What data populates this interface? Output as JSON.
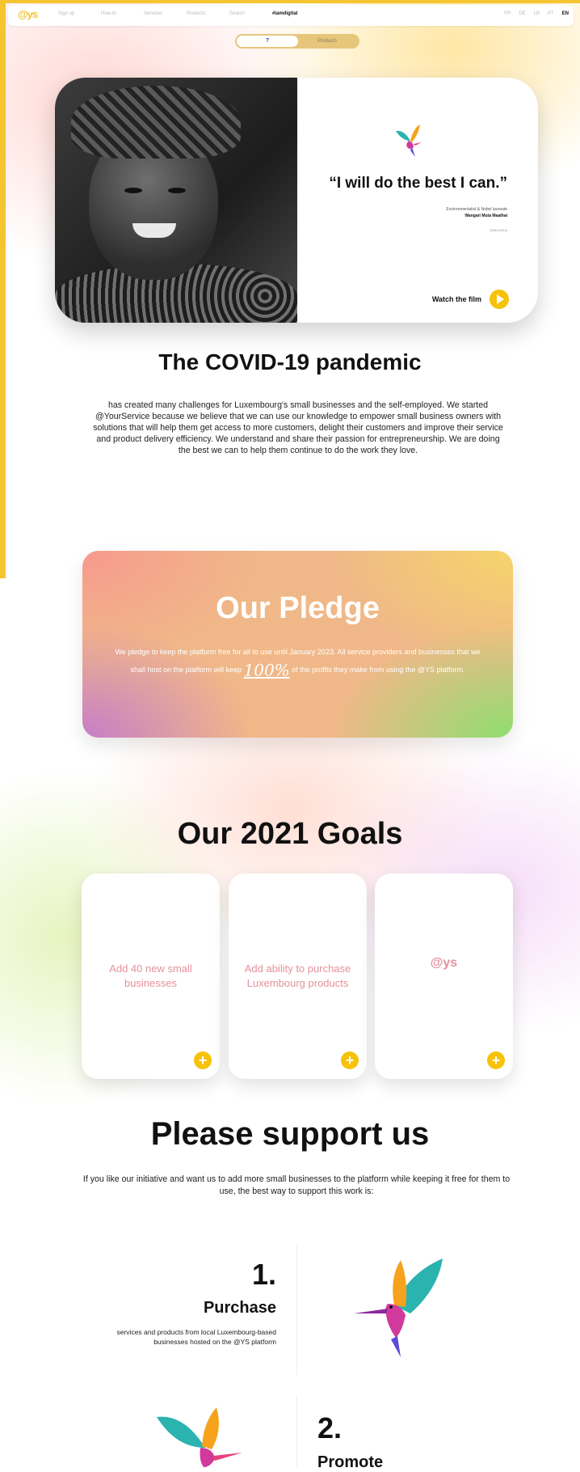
{
  "nav": {
    "logo": "@ys",
    "links": [
      "Sign up",
      "How-to",
      "Services",
      "Products",
      "Search",
      "#iamdigital"
    ],
    "active_index": 5,
    "right_links": [
      "FR",
      "DE",
      "LB",
      "PT",
      "EN"
    ],
    "right_active_index": 4
  },
  "toggle": {
    "option_a": "?",
    "option_b": "Products"
  },
  "hero": {
    "quote": "“I will do the best I can.”",
    "attribution_role": "Environmentalist & Nobel laureate",
    "attribution_name": "Wangari Muta Maathai",
    "attribution_years": "(1940-2011)",
    "watch_label": "Watch the film"
  },
  "covid": {
    "heading": "The COVID-19 pandemic",
    "body": "has created many challenges for Luxembourg's small businesses and the self-employed. We started @YourService because we believe that we can use our knowledge to empower small business owners with solutions that will help them get access to more customers, delight their customers and improve their service and product delivery efficiency. We understand and share their passion for entrepreneurship. We are doing the best we can to help them continue to do the work they love."
  },
  "pledge": {
    "heading": "Our Pledge",
    "body_before": "We pledge to keep the platform free for all to use until January 2023. All service providers and businesses that we shall host on the platform will keep",
    "hundred": "100%",
    "body_after": "of the profits they make from using the @YS platform."
  },
  "goals": {
    "heading": "Our 2021 Goals",
    "items": [
      {
        "text": "Add 40 new small businesses"
      },
      {
        "text": "Add ability to purchase Luxembourg products"
      },
      {
        "text": "@ys"
      }
    ]
  },
  "support": {
    "heading": "Please support us",
    "intro": "If you like our initiative and want us to add more small businesses to the platform while keeping it free for them to use, the best way to support this work is:",
    "steps": [
      {
        "number": "1.",
        "title": "Purchase",
        "desc": "services and products from local Luxembourg-based businesses hosted on the @YS platform"
      },
      {
        "number": "2.",
        "title": "Promote"
      }
    ]
  },
  "colors": {
    "accent": "#f4c431",
    "pledge_pink": "#f79a8e",
    "pledge_green": "#8ede70",
    "goal_text": "#e6919c"
  }
}
